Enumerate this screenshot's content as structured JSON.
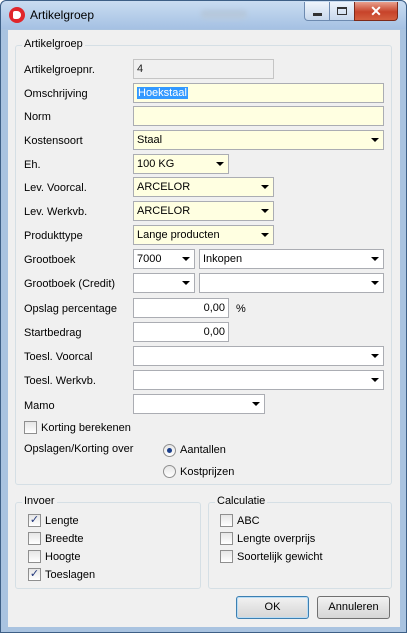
{
  "window": {
    "title": "Artikelgroep"
  },
  "main_group": {
    "legend": "Artikelgroep",
    "artikelgroepnr": {
      "label": "Artikelgroepnr.",
      "value": "4"
    },
    "omschrijving": {
      "label": "Omschrijving",
      "value": "Hoekstaal"
    },
    "norm": {
      "label": "Norm",
      "value": ""
    },
    "kostensoort": {
      "label": "Kostensoort",
      "value": "Staal"
    },
    "eh": {
      "label": "Eh.",
      "value": "100 KG"
    },
    "lev_voorcal": {
      "label": "Lev. Voorcal.",
      "value": "ARCELOR"
    },
    "lev_werkvb": {
      "label": "Lev. Werkvb.",
      "value": "ARCELOR"
    },
    "produkttype": {
      "label": "Produkttype",
      "value": "Lange producten"
    },
    "grootboek": {
      "label": "Grootboek",
      "value": "7000",
      "value2": "Inkopen"
    },
    "grootboek_credit": {
      "label": "Grootboek (Credit)",
      "value": "",
      "value2": ""
    },
    "opslag": {
      "label": "Opslag percentage",
      "value": "0,00",
      "unit": "%"
    },
    "startbedrag": {
      "label": "Startbedrag",
      "value": "0,00"
    },
    "toesl_voorcal": {
      "label": "Toesl. Voorcal",
      "value": ""
    },
    "toesl_werkvb": {
      "label": "Toesl. Werkvb.",
      "value": ""
    },
    "mamo": {
      "label": "Mamo",
      "value": ""
    },
    "korting": {
      "label": "Korting berekenen",
      "checked": false
    },
    "opslagen_korting": {
      "label": "Opslagen/Korting over",
      "options": [
        {
          "label": "Aantallen",
          "selected": true
        },
        {
          "label": "Kostprijzen",
          "selected": false
        }
      ]
    }
  },
  "invoer": {
    "legend": "Invoer",
    "items": [
      {
        "label": "Lengte",
        "checked": true
      },
      {
        "label": "Breedte",
        "checked": false
      },
      {
        "label": "Hoogte",
        "checked": false
      },
      {
        "label": "Toeslagen",
        "checked": true
      }
    ]
  },
  "calculatie": {
    "legend": "Calculatie",
    "items": [
      {
        "label": "ABC",
        "checked": false
      },
      {
        "label": "Lengte overprijs",
        "checked": false
      },
      {
        "label": "Soortelijk gewicht",
        "checked": false
      }
    ]
  },
  "buttons": {
    "ok": "OK",
    "cancel": "Annuleren"
  },
  "colors": {
    "required_field": "#ffffe1",
    "selection": "#3399ff",
    "close_button": "#c7432a"
  }
}
